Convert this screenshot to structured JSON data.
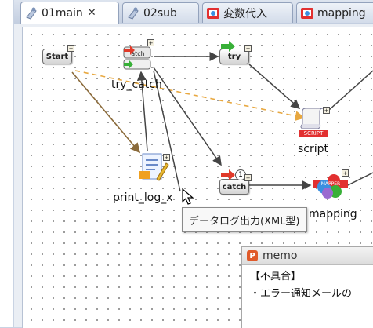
{
  "tabs": [
    {
      "label": "01main",
      "active": true,
      "close": "✕"
    },
    {
      "label": "02sub",
      "active": false
    },
    {
      "label": "変数代入",
      "active": false
    },
    {
      "label": "mapping",
      "active": false
    }
  ],
  "nodes": {
    "start": {
      "label": "Start"
    },
    "try_catch": {
      "label": "try_catch"
    },
    "try": {
      "label": "try"
    },
    "catch": {
      "label": "catch"
    },
    "script": {
      "label": "script",
      "icon_text": "SCRIPT"
    },
    "print_log": {
      "label": "print_log_x"
    },
    "mapping": {
      "label": "mapping",
      "icon_text": "MAPPER"
    }
  },
  "tooltip": {
    "text": "データログ出力(XML型)"
  },
  "memo": {
    "title": "memo",
    "lines": [
      "【不具合】",
      "・エラー通知メールの"
    ]
  },
  "colors": {
    "arrow": "#444444",
    "dashed_arrow": "#e8a840",
    "green_arrow": "#38b038",
    "red_arrow": "#e03a2a",
    "accent_red": "#e23030"
  }
}
